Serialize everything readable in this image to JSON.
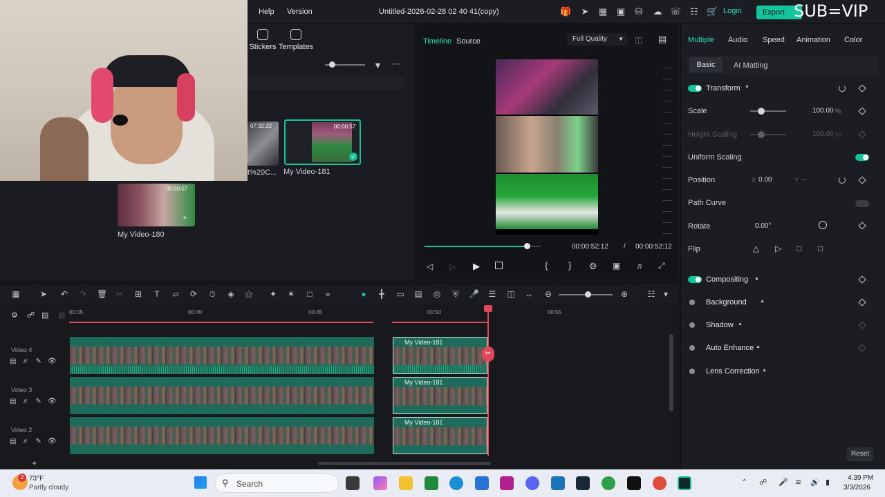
{
  "topbar": {
    "menu": [
      "Help",
      "Version"
    ],
    "project_title": "Untitled-2026-02-28 02 40 41(copy)",
    "login": "Login",
    "export": "Export",
    "overlay_text": "SUB=VIP"
  },
  "media": {
    "tabs": [
      "Stickers",
      "Templates"
    ],
    "items": [
      {
        "duration": "07:32:32",
        "label": "t%20C..."
      },
      {
        "duration": "00:00:57",
        "label": "My Video-181"
      },
      {
        "duration": "00:00:57",
        "label": "My Video-180"
      }
    ]
  },
  "player": {
    "tabs": [
      "Timeline",
      "Source"
    ],
    "quality": "Full Quality",
    "current_time": "00:00:52:12",
    "separator": "/",
    "total_time": "00:00:52:12",
    "progress": 0.88
  },
  "props": {
    "tabs": [
      "Multiple",
      "Audio",
      "Speed",
      "Animation",
      "Color"
    ],
    "subtabs": [
      "Basic",
      "AI Matting"
    ],
    "transform": "Transform",
    "scale_label": "Scale",
    "scale_value": "100.00",
    "scale_unit": "%",
    "height_label": "Height Scaling",
    "height_value": "100.00",
    "height_unit": "%",
    "uniform_label": "Uniform Scaling",
    "position_label": "Position",
    "x_axis": "X",
    "x_value": "0.00",
    "y_axis": "Y",
    "y_value": "--",
    "path_label": "Path Curve",
    "rotate_label": "Rotate",
    "rotate_value": "0.00°",
    "flip_label": "Flip",
    "compositing": "Compositing",
    "background": "Background",
    "shadow": "Shadow",
    "auto_enhance": "Auto Enhance",
    "lens": "Lens Correction",
    "reset": "Reset"
  },
  "timeline": {
    "ruler": [
      "00:35",
      "00:40",
      "00:45",
      "00:50",
      "00:55"
    ],
    "tracks": [
      {
        "name": "Video 4",
        "clip": "My Video-181"
      },
      {
        "name": "Video 3",
        "clip": "My Video-181"
      },
      {
        "name": "Video 2",
        "clip": "My Video-181"
      }
    ]
  },
  "taskbar": {
    "temperature": "73°F",
    "weather": "Partly cloudy",
    "badge": "2",
    "search": "Search",
    "time": "4:39 PM",
    "date": "3/3/2026"
  }
}
